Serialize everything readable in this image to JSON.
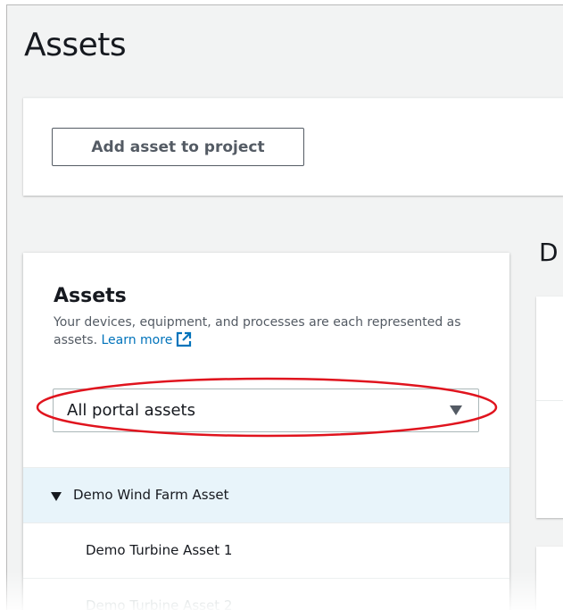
{
  "page": {
    "title": "Assets"
  },
  "actions": {
    "add_asset_label": "Add asset to project"
  },
  "detail": {
    "heading_fragment": "D"
  },
  "assets_panel": {
    "heading": "Assets",
    "description": "Your devices, equipment, and processes are each represented as assets.",
    "learn_more": "Learn more",
    "filter": {
      "selected": "All portal assets"
    },
    "tree": [
      {
        "label": "Demo Wind Farm Asset",
        "level": 0,
        "expanded": true,
        "selected": true
      },
      {
        "label": "Demo Turbine Asset 1",
        "level": 1
      },
      {
        "label": "Demo Turbine Asset 2",
        "level": 1
      }
    ]
  },
  "colors": {
    "link": "#0073bb",
    "highlight": "#e0141e",
    "selected_row": "#e8f4fa"
  }
}
